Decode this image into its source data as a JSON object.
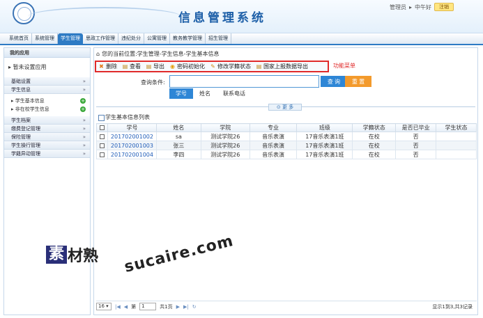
{
  "header": {
    "title": "信息管理系统",
    "user": "管理员",
    "greeting": "中午好",
    "logout": "注销"
  },
  "nav": [
    "系统首页",
    "系统管理",
    "学生管理",
    "思政工作管理",
    "违纪处分",
    "公寓管理",
    "教务教学管理",
    "招生管理"
  ],
  "nav_active": "学生管理",
  "sidebar": {
    "head": "我的应用",
    "sub": "暂未设置应用",
    "groups_top": [
      {
        "label": "基础设置",
        "chev": "»"
      },
      {
        "label": "学生信息",
        "chev": "»"
      }
    ],
    "items": [
      {
        "label": "学生基本信息"
      },
      {
        "label": "非在校学生信息"
      }
    ],
    "groups_bottom": [
      {
        "label": "学生档案",
        "chev": "»"
      },
      {
        "label": "缴费登记管理",
        "chev": "»"
      },
      {
        "label": "保险管理",
        "chev": "»"
      },
      {
        "label": "学生操行管理",
        "chev": "»"
      },
      {
        "label": "学籍异动管理",
        "chev": "»"
      }
    ]
  },
  "breadcrumb": "您的当前位置:学生管理-学生信息-学生基本信息",
  "toolbar": {
    "delete": "删除",
    "view": "查看",
    "export": "导出",
    "reset_pwd": "密码初始化",
    "edit_status": "修改学籍状态",
    "national_export": "国家上报数据导出"
  },
  "func_label": "功能菜单",
  "search": {
    "label": "查询条件:",
    "value": "",
    "query": "查 询",
    "reset": "重 置",
    "tabs": [
      "学号",
      "姓名",
      "联系电话"
    ],
    "more": "更 多"
  },
  "list": {
    "title": "学生基本信息列表",
    "columns": [
      "学号",
      "姓名",
      "学院",
      "专业",
      "班级",
      "学籍状态",
      "是否已毕业",
      "学生状态"
    ],
    "rows": [
      [
        "201702001002",
        "sa",
        "测试学院26",
        "音乐表演",
        "17音乐表演1班",
        "在校",
        "否",
        ""
      ],
      [
        "201702001003",
        "张三",
        "测试学院26",
        "音乐表演",
        "17音乐表演1班",
        "在校",
        "否",
        ""
      ],
      [
        "201702001004",
        "李四",
        "测试学院26",
        "音乐表演",
        "17音乐表演1班",
        "在校",
        "否",
        ""
      ]
    ]
  },
  "pager": {
    "page_size": "16",
    "page_prefix": "第",
    "page": "1",
    "total_pages": "共1页",
    "info": "显示1到3,共3记录"
  },
  "watermark": {
    "brand": "素",
    "brand_rest": "材熟",
    "url": "sucaire.com"
  }
}
